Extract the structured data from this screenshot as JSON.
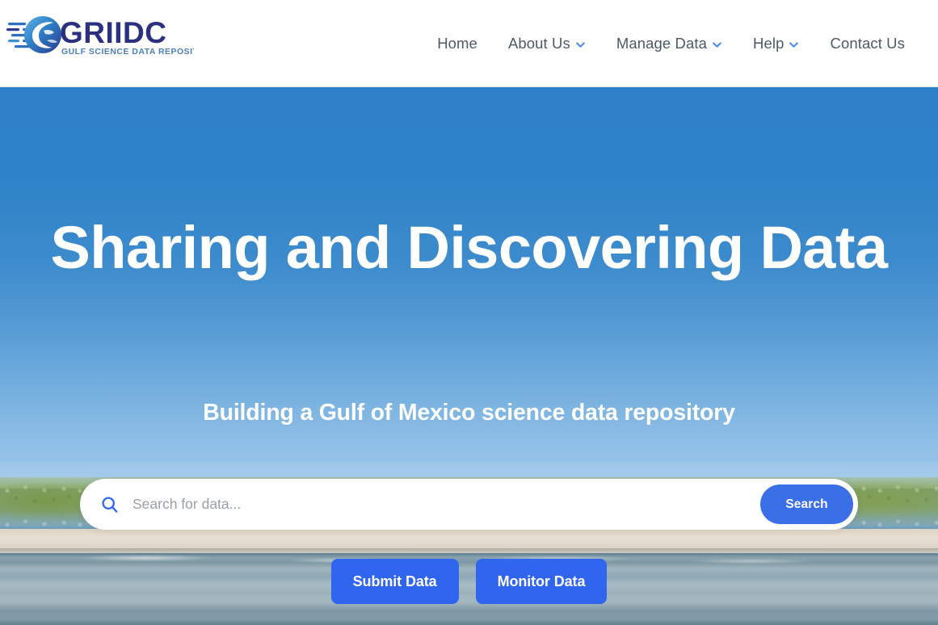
{
  "header": {
    "logo": {
      "icon_name": "griidc-globe-logo",
      "wordmark": "GRIIDC",
      "tagline": "GULF SCIENCE DATA REPOSITORY",
      "wordmark_color": "#2b317f",
      "tagline_color": "#4a7fc1",
      "globe_color": "#2f6fc0"
    },
    "nav": [
      {
        "label": "Home",
        "has_dropdown": false
      },
      {
        "label": "About Us",
        "has_dropdown": true
      },
      {
        "label": "Manage Data",
        "has_dropdown": true
      },
      {
        "label": "Help",
        "has_dropdown": true
      },
      {
        "label": "Contact Us",
        "has_dropdown": false
      }
    ],
    "nav_text_color": "#4d5a66",
    "chevron_color": "#4285f4",
    "background_color": "#ffffff"
  },
  "hero": {
    "title": "Sharing and Discovering Data",
    "subtitle": "Building a Gulf of Mexico science data repository",
    "sky_color_top": "#2d80c6",
    "sky_color_bottom": "#9cc6e9",
    "title_color": "#ffffff",
    "search": {
      "placeholder": "Search for data...",
      "value": "",
      "icon_name": "search-icon",
      "icon_color": "#2f65ef",
      "button_label": "Search",
      "button_color": "#3b6fe8"
    },
    "actions": [
      {
        "label": "Submit Data",
        "color": "#2f65ef"
      },
      {
        "label": "Monitor Data",
        "color": "#2f65ef"
      }
    ]
  }
}
